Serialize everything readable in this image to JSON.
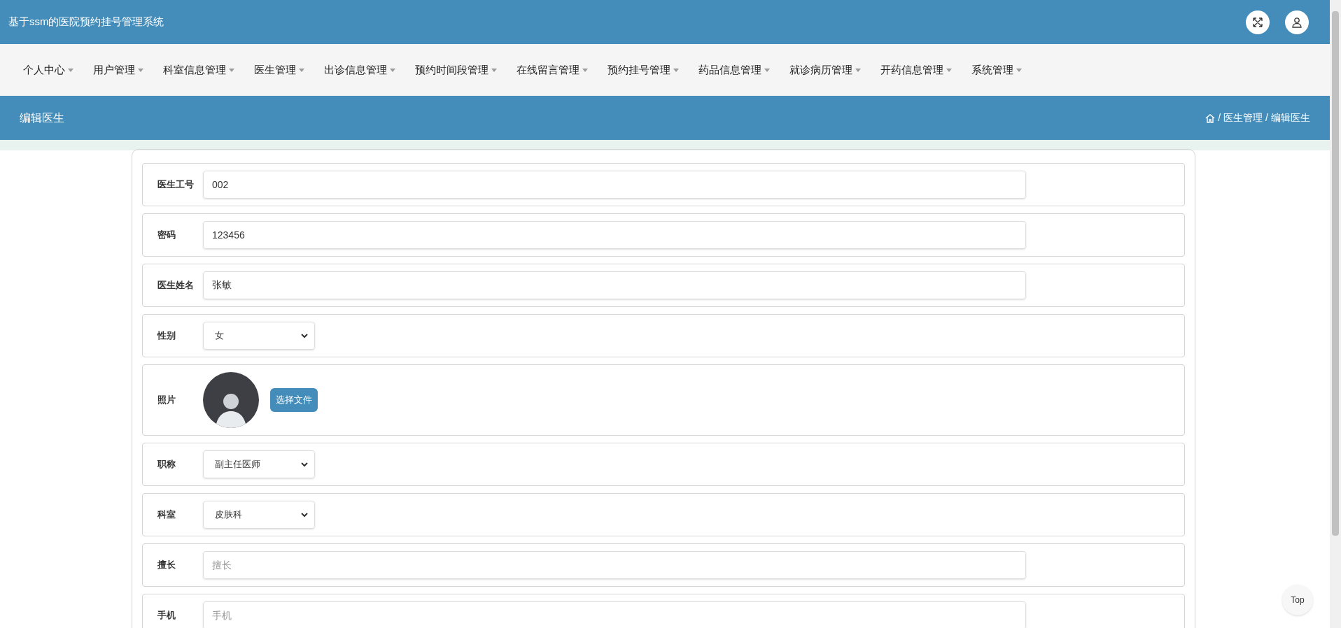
{
  "header": {
    "title": "基于ssm的医院预约挂号管理系统"
  },
  "nav": [
    "个人中心",
    "用户管理",
    "科室信息管理",
    "医生管理",
    "出诊信息管理",
    "预约时间段管理",
    "在线留言管理",
    "预约挂号管理",
    "药品信息管理",
    "就诊病历管理",
    "开药信息管理",
    "系统管理"
  ],
  "page_title": "编辑医生",
  "breadcrumb": [
    "医生管理",
    "编辑医生"
  ],
  "breadcrumb_separator": "/",
  "form": [
    {
      "kind": "text",
      "label": "医生工号",
      "value": "002"
    },
    {
      "kind": "text",
      "label": "密码",
      "value": "123456"
    },
    {
      "kind": "text",
      "label": "医生姓名",
      "value": "张敏"
    },
    {
      "kind": "select",
      "label": "性别",
      "value": "女"
    },
    {
      "kind": "image",
      "label": "照片",
      "button": "选择文件"
    },
    {
      "kind": "select",
      "label": "职称",
      "value": "副主任医师"
    },
    {
      "kind": "select",
      "label": "科室",
      "value": "皮肤科"
    },
    {
      "kind": "text",
      "label": "擅长",
      "placeholder": "擅长"
    },
    {
      "kind": "text",
      "label": "手机",
      "placeholder": "手机"
    }
  ],
  "top_button": "Top"
}
